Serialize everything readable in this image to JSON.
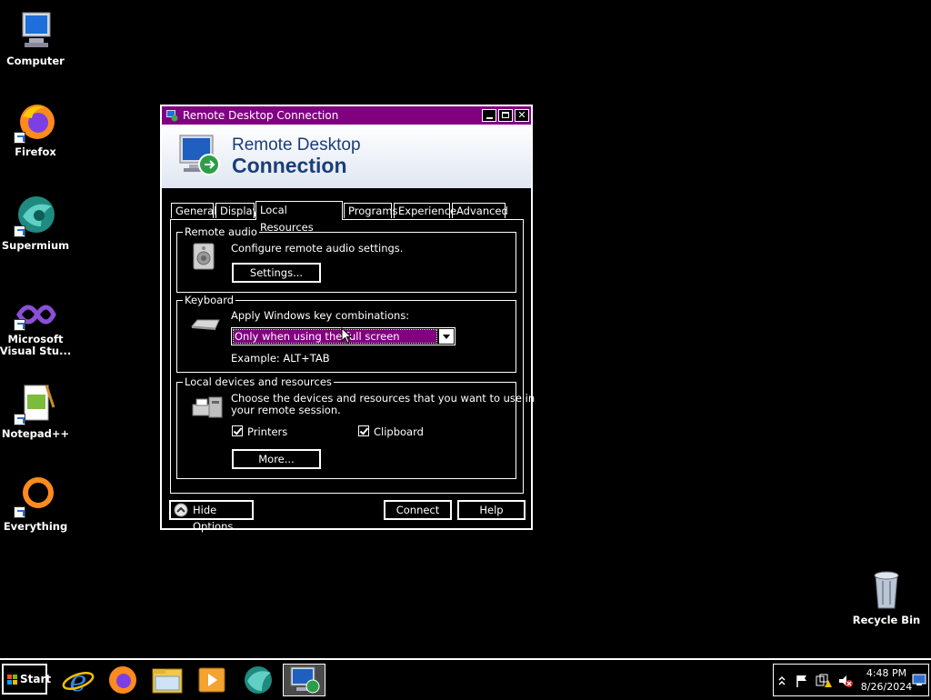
{
  "desktop": {
    "icons": [
      {
        "label": "Computer"
      },
      {
        "label": "Firefox"
      },
      {
        "label": "Supermium"
      },
      {
        "label": "Microsoft Visual Stu..."
      },
      {
        "label": "Notepad++"
      },
      {
        "label": "Everything"
      },
      {
        "label": "Recycle Bin"
      }
    ]
  },
  "window": {
    "title": "Remote Desktop Connection",
    "banner_line1": "Remote Desktop",
    "banner_line2": "Connection",
    "tabs": [
      "General",
      "Display",
      "Local Resources",
      "Programs",
      "Experience",
      "Advanced"
    ],
    "active_tab": "Local Resources",
    "remote_audio": {
      "legend": "Remote audio",
      "description": "Configure remote audio settings.",
      "settings_button": "Settings..."
    },
    "keyboard": {
      "legend": "Keyboard",
      "label": "Apply Windows key combinations:",
      "selected": "Only when using the full screen",
      "example": "Example: ALT+TAB"
    },
    "local_devices": {
      "legend": "Local devices and resources",
      "description_line1": "Choose the devices and resources that you want to use in",
      "description_line2": "your remote session.",
      "printers_label": "Printers",
      "printers_checked": true,
      "clipboard_label": "Clipboard",
      "clipboard_checked": true,
      "more_button": "More..."
    },
    "hide_options_button": "Hide Options",
    "connect_button": "Connect",
    "help_button": "Help"
  },
  "taskbar": {
    "start_label": "Start",
    "pinned": [
      "internet-explorer-icon",
      "firefox-icon",
      "file-explorer-icon",
      "media-player-icon",
      "supermium-icon",
      "remote-desktop-icon"
    ],
    "clock_time": "4:48 PM",
    "clock_date": "8/26/2024"
  },
  "colors": {
    "background": "#000000",
    "title_bar": "#800080",
    "selection": "#800080",
    "foreground": "#ffffff"
  }
}
